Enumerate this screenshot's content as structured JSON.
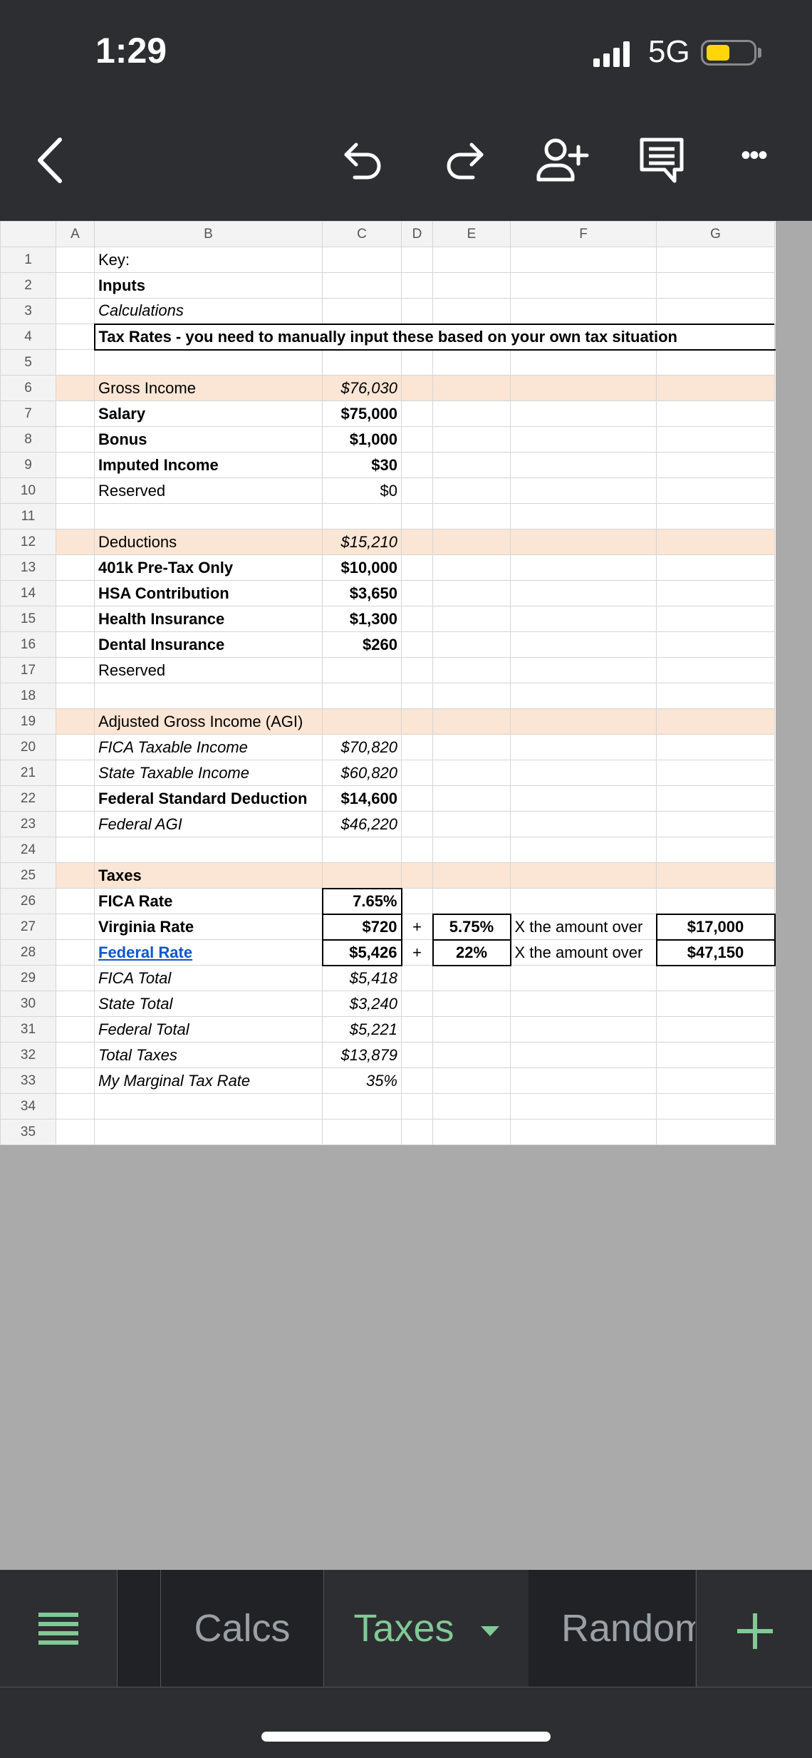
{
  "status": {
    "time": "1:29",
    "network": "5G"
  },
  "toolbar": {
    "icons": [
      "back-icon",
      "undo-icon",
      "redo-icon",
      "add-person-icon",
      "comment-icon",
      "more-icon"
    ],
    "more_glyph": "•••"
  },
  "columns": [
    "",
    "A",
    "B",
    "C",
    "D",
    "E",
    "F",
    "G"
  ],
  "rows": [
    {
      "n": "1",
      "b": "Key:"
    },
    {
      "n": "2",
      "b": "Inputs"
    },
    {
      "n": "3",
      "b": "Calculations"
    },
    {
      "n": "4",
      "b": "Tax Rates - you need to manually input these based on your own tax situation"
    },
    {
      "n": "5"
    },
    {
      "n": "6",
      "b": "Gross Income",
      "c": "$76,030"
    },
    {
      "n": "7",
      "b": "Salary",
      "c": "$75,000"
    },
    {
      "n": "8",
      "b": "Bonus",
      "c": "$1,000"
    },
    {
      "n": "9",
      "b": "Imputed Income",
      "c": "$30"
    },
    {
      "n": "10",
      "b": "Reserved",
      "c": "$0"
    },
    {
      "n": "11"
    },
    {
      "n": "12",
      "b": "Deductions",
      "c": "$15,210"
    },
    {
      "n": "13",
      "b": "401k Pre-Tax Only",
      "c": "$10,000"
    },
    {
      "n": "14",
      "b": "HSA Contribution",
      "c": "$3,650"
    },
    {
      "n": "15",
      "b": "Health Insurance",
      "c": "$1,300"
    },
    {
      "n": "16",
      "b": "Dental Insurance",
      "c": "$260"
    },
    {
      "n": "17",
      "b": "Reserved"
    },
    {
      "n": "18"
    },
    {
      "n": "19",
      "b": "Adjusted Gross Income (AGI)"
    },
    {
      "n": "20",
      "b": "FICA Taxable Income",
      "c": "$70,820"
    },
    {
      "n": "21",
      "b": "State Taxable Income",
      "c": "$60,820"
    },
    {
      "n": "22",
      "b": "Federal Standard Deduction",
      "c": "$14,600"
    },
    {
      "n": "23",
      "b": "Federal AGI",
      "c": "$46,220"
    },
    {
      "n": "24"
    },
    {
      "n": "25",
      "b": "Taxes"
    },
    {
      "n": "26",
      "b": "FICA Rate",
      "c": "7.65%"
    },
    {
      "n": "27",
      "b": "Virginia Rate",
      "c": "$720",
      "d": "+",
      "e": "5.75%",
      "f": "X the amount over",
      "g": "$17,000"
    },
    {
      "n": "28",
      "b": "Federal Rate",
      "c": "$5,426",
      "d": "+",
      "e": "22%",
      "f": "X the amount over",
      "g": "$47,150"
    },
    {
      "n": "29",
      "b": "FICA Total",
      "c": "$5,418"
    },
    {
      "n": "30",
      "b": "State Total",
      "c": "$3,240"
    },
    {
      "n": "31",
      "b": "Federal Total",
      "c": "$5,221"
    },
    {
      "n": "32",
      "b": "Total Taxes",
      "c": "$13,879"
    },
    {
      "n": "33",
      "b": "My Marginal Tax Rate",
      "c": "35%"
    },
    {
      "n": "34"
    },
    {
      "n": "35"
    }
  ],
  "tabs": [
    {
      "label": "Calcs"
    },
    {
      "label": "Taxes",
      "active": true
    },
    {
      "label": "Random"
    }
  ],
  "colors": {
    "band": "#fbe5d4",
    "accent": "#81c995",
    "link": "#1155cc",
    "chrome": "#2d2e32"
  }
}
